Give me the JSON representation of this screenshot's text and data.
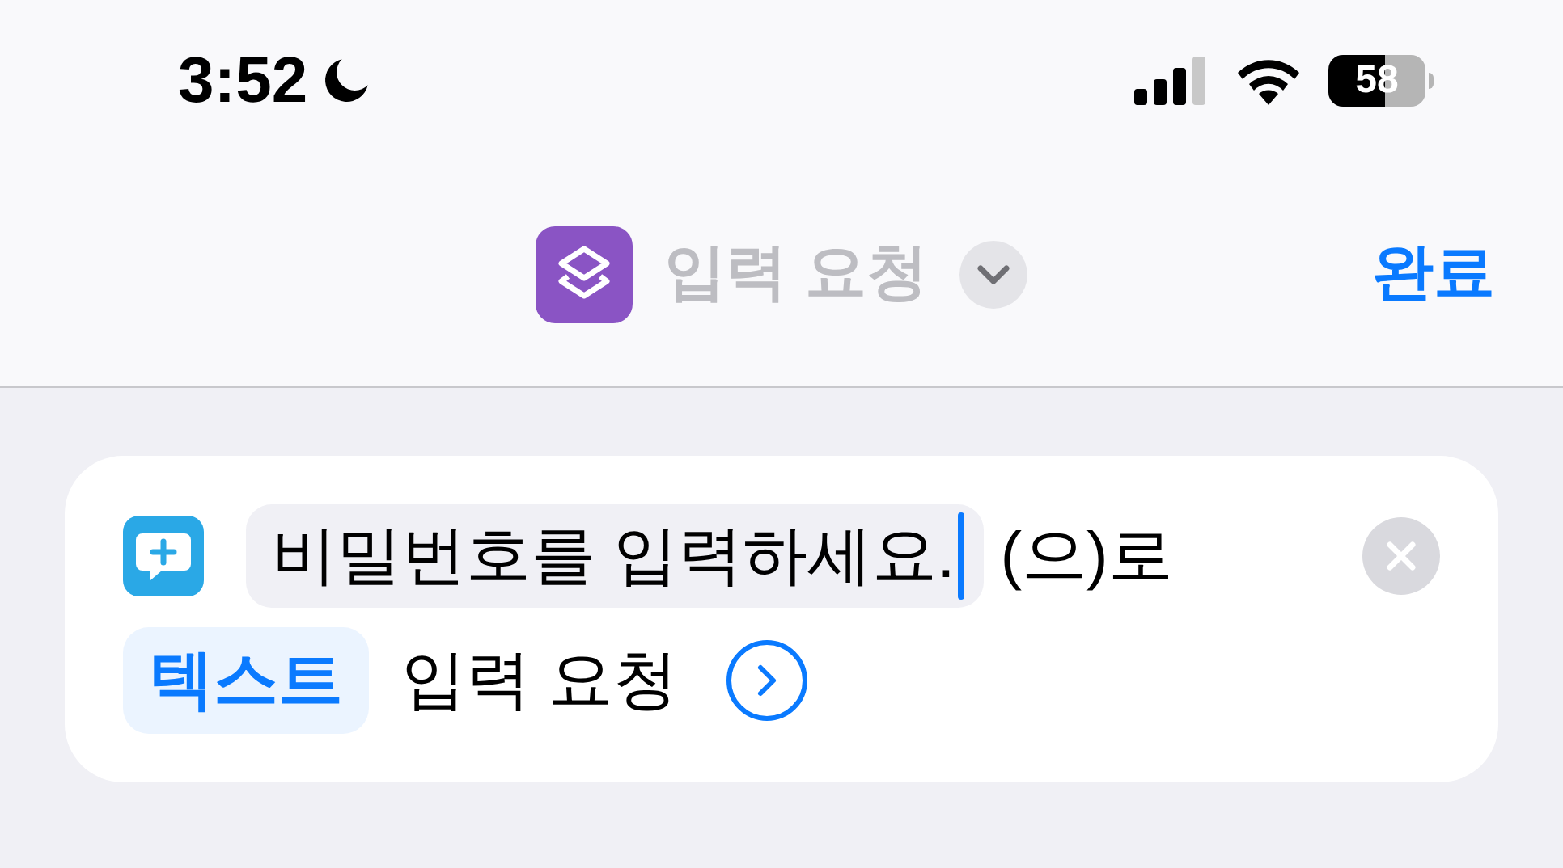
{
  "status_bar": {
    "time": "3:52",
    "focus_moon": true,
    "battery": "58"
  },
  "nav": {
    "title": "입력 요청",
    "done": "완료"
  },
  "action": {
    "field": {
      "value": "비밀번호를 입력하세요.",
      "focused": true
    },
    "suffix": "(으)로",
    "type_token": "텍스트",
    "label": "입력 요청"
  }
}
